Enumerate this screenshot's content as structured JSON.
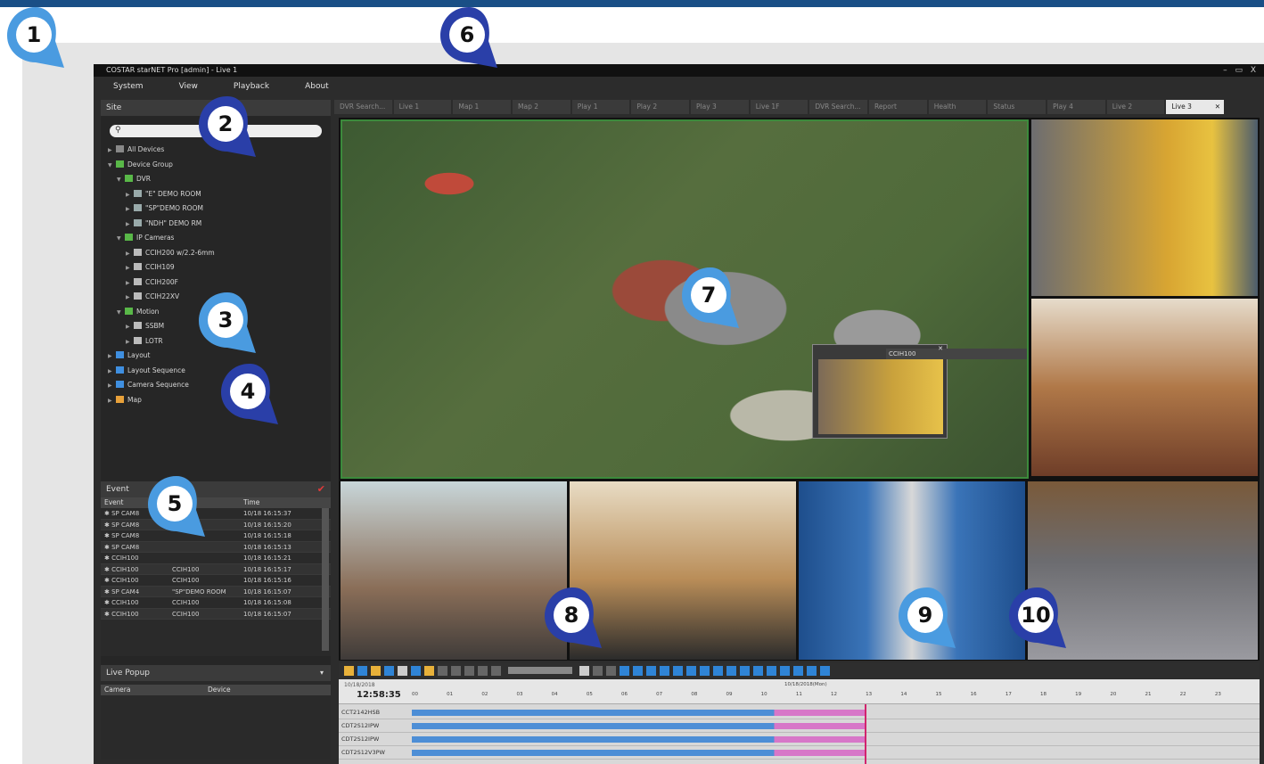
{
  "app": {
    "title": "COSTAR starNET Pro [admin] - Live 1",
    "window_controls": "– ▭ X"
  },
  "menu": [
    "System",
    "View",
    "Playback",
    "About"
  ],
  "site_panel": {
    "header": "Site",
    "search_icon": "⚲",
    "tree": [
      {
        "label": "All Devices",
        "level": 0,
        "icon": "gray"
      },
      {
        "label": "Device Group",
        "level": 0,
        "icon": "green"
      },
      {
        "label": "DVR",
        "level": 1,
        "icon": "green"
      },
      {
        "label": "\"E\" DEMO ROOM",
        "level": 2,
        "icon": "dvr"
      },
      {
        "label": "\"SP\"DEMO ROOM",
        "level": 2,
        "icon": "dvr"
      },
      {
        "label": "\"NDH\" DEMO RM",
        "level": 2,
        "icon": "dvr"
      },
      {
        "label": "IP Cameras",
        "level": 1,
        "icon": "green"
      },
      {
        "label": "CCIH200 w/2.2-6mm",
        "level": 2,
        "icon": "cam"
      },
      {
        "label": "CCIH109",
        "level": 2,
        "icon": "cam"
      },
      {
        "label": "CCIH200F",
        "level": 2,
        "icon": "cam"
      },
      {
        "label": "CCIH22XV",
        "level": 2,
        "icon": "cam"
      },
      {
        "label": "Motion",
        "level": 1,
        "icon": "green"
      },
      {
        "label": "SSBM",
        "level": 2,
        "icon": "cam"
      },
      {
        "label": "LOTR",
        "level": 2,
        "icon": "cam"
      },
      {
        "label": "Layout",
        "level": 0,
        "icon": "blue"
      },
      {
        "label": "Layout Sequence",
        "level": 0,
        "icon": "blue"
      },
      {
        "label": "Camera Sequence",
        "level": 0,
        "icon": "blue"
      },
      {
        "label": "Map",
        "level": 0,
        "icon": "orange"
      }
    ]
  },
  "event_panel": {
    "header": "Event",
    "columns": [
      "Event",
      "",
      "Time"
    ],
    "rows": [
      [
        "SP CAM8",
        "",
        "10/18 16:15:37"
      ],
      [
        "SP CAM8",
        "",
        "10/18 16:15:20"
      ],
      [
        "SP CAM8",
        "",
        "10/18 16:15:18"
      ],
      [
        "SP CAM8",
        "",
        "10/18 16:15:13"
      ],
      [
        "CCIH100",
        "",
        "10/18 16:15:21"
      ],
      [
        "CCIH100",
        "CCIH100",
        "10/18 16:15:17"
      ],
      [
        "CCIH100",
        "CCIH100",
        "10/18 16:15:16"
      ],
      [
        "SP CAM4",
        "\"SP\"DEMO ROOM",
        "10/18 16:15:07"
      ],
      [
        "CCIH100",
        "CCIH100",
        "10/18 16:15:08"
      ],
      [
        "CCIH100",
        "CCIH100",
        "10/18 16:15:07"
      ]
    ]
  },
  "live_popup": {
    "header": "Live Popup",
    "columns": [
      "Camera",
      "Device"
    ]
  },
  "tabs": [
    {
      "label": "DVR Search...",
      "active": false
    },
    {
      "label": "Live 1",
      "active": false
    },
    {
      "label": "Map 1",
      "active": false
    },
    {
      "label": "Map 2",
      "active": false
    },
    {
      "label": "Play 1",
      "active": false
    },
    {
      "label": "Play 2",
      "active": false
    },
    {
      "label": "Play 3",
      "active": false
    },
    {
      "label": "Live 1F",
      "active": false
    },
    {
      "label": "DVR Search...",
      "active": false
    },
    {
      "label": "Report",
      "active": false
    },
    {
      "label": "Health",
      "active": false
    },
    {
      "label": "Status",
      "active": false
    },
    {
      "label": "Play 4",
      "active": false
    },
    {
      "label": "Live 2",
      "active": false
    },
    {
      "label": "Live 3",
      "active": true
    }
  ],
  "video": {
    "subwindow_title": "CCIH100"
  },
  "timeline": {
    "date": "10/18/2018",
    "time": "12:58:35",
    "center_label": "10/18/2018(Mon)",
    "hours": [
      "00",
      "01",
      "02",
      "03",
      "04",
      "05",
      "06",
      "07",
      "08",
      "09",
      "10",
      "11",
      "12",
      "13",
      "14",
      "15",
      "16",
      "17",
      "18",
      "19",
      "20",
      "21",
      "22",
      "23"
    ],
    "rows": [
      "CCT2142HSB",
      "CDT2S12IPW",
      "CDT2S12IPW",
      "CDT2S12V3PW"
    ],
    "cursor_hour": 12.97
  },
  "callouts": [
    "1",
    "2",
    "3",
    "4",
    "5",
    "6",
    "7",
    "8",
    "9",
    "10"
  ],
  "colors": {
    "accent": "#1a4f86",
    "callout_light": "#4a9be0",
    "callout_dark": "#2a3fa8",
    "selection": "#3c8a3c"
  }
}
